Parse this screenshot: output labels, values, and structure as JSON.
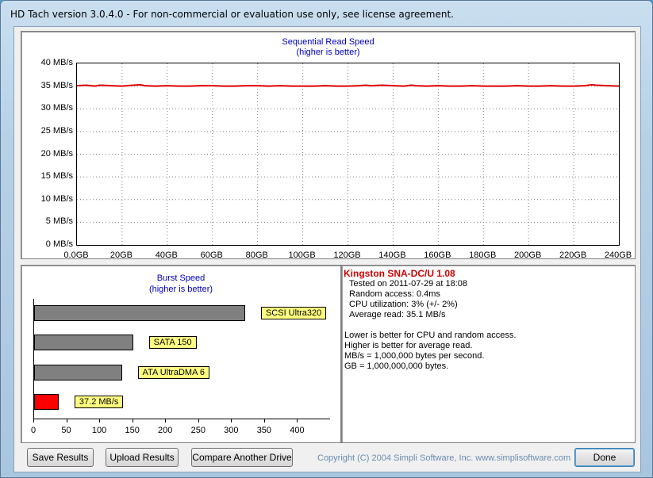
{
  "window": {
    "title": "HD Tach version 3.0.4.0  - For non-commercial or evaluation use only, see license agreement."
  },
  "sequential": {
    "title_line1": "Sequential Read Speed",
    "title_line2": "(higher is better)"
  },
  "burst": {
    "title_line1": "Burst Speed",
    "title_line2": "(higher is better)"
  },
  "chart_data": [
    {
      "type": "line",
      "title": "Sequential Read Speed",
      "subtitle": "(higher is better)",
      "y_ticks": [
        "0 MB/s",
        "5 MB/s",
        "10 MB/s",
        "15 MB/s",
        "20 MB/s",
        "25 MB/s",
        "30 MB/s",
        "35 MB/s",
        "40 MB/s"
      ],
      "x_ticks": [
        "0.0GB",
        "20GB",
        "40GB",
        "60GB",
        "80GB",
        "100GB",
        "120GB",
        "140GB",
        "160GB",
        "180GB",
        "200GB",
        "220GB",
        "240GB"
      ],
      "xlim": [
        0,
        240
      ],
      "ylim": [
        0,
        40
      ],
      "grid": true,
      "series": [
        {
          "color": "#e00000",
          "x": [
            0,
            4,
            8,
            10,
            15,
            20,
            25,
            28,
            30,
            35,
            40,
            45,
            50,
            55,
            60,
            65,
            70,
            75,
            80,
            85,
            90,
            95,
            100,
            105,
            110,
            115,
            120,
            125,
            128,
            130,
            135,
            140,
            145,
            148,
            150,
            155,
            160,
            165,
            170,
            175,
            180,
            185,
            190,
            195,
            200,
            205,
            210,
            215,
            220,
            225,
            228,
            230,
            235,
            240
          ],
          "y": [
            35.1,
            35.2,
            35.0,
            35.2,
            35.1,
            35.0,
            35.2,
            35.3,
            35.1,
            35.0,
            35.1,
            35.0,
            35.0,
            35.1,
            35.1,
            35.0,
            35.0,
            35.1,
            35.1,
            35.0,
            35.1,
            35.0,
            35.0,
            35.0,
            35.1,
            35.0,
            35.0,
            35.1,
            35.2,
            35.1,
            35.2,
            35.1,
            35.0,
            35.2,
            35.1,
            35.0,
            35.1,
            35.0,
            35.0,
            35.1,
            35.0,
            35.0,
            35.0,
            35.1,
            35.0,
            35.0,
            35.1,
            35.0,
            35.0,
            35.1,
            35.3,
            35.2,
            35.1,
            35.0
          ]
        }
      ]
    },
    {
      "type": "bar",
      "title": "Burst Speed",
      "subtitle": "(higher is better)",
      "orientation": "horizontal",
      "x_ticks": [
        "0",
        "50",
        "100",
        "150",
        "200",
        "250",
        "300",
        "350",
        "400"
      ],
      "xlim": [
        0,
        450
      ],
      "bars": [
        {
          "label": "SCSI Ultra320",
          "value": 320,
          "color": "#808080"
        },
        {
          "label": "SATA 150",
          "value": 150,
          "color": "#808080"
        },
        {
          "label": "ATA UltraDMA 6",
          "value": 133,
          "color": "#808080"
        },
        {
          "label": "37.2 MB/s",
          "value": 37.2,
          "color": "#ff0000"
        }
      ]
    }
  ],
  "info": {
    "drive": "Kingston SNA-DC/U 1.08",
    "lines": [
      "Tested on 2011-07-29 at 18:08",
      "Random access: 0.4ms",
      "CPU utilization: 3% (+/- 2%)",
      "Average read: 35.1 MB/s"
    ],
    "notes": [
      "Lower is better for CPU and random access.",
      "Higher is better for average read.",
      "MB/s = 1,000,000 bytes per second.",
      "GB = 1,000,000,000 bytes."
    ]
  },
  "buttons": {
    "save": "Save Results",
    "upload": "Upload Results",
    "compare": "Compare Another Drive",
    "done": "Done"
  },
  "copyright": "Copyright (C) 2004 Simpli Software, Inc. www.simplisoftware.com"
}
